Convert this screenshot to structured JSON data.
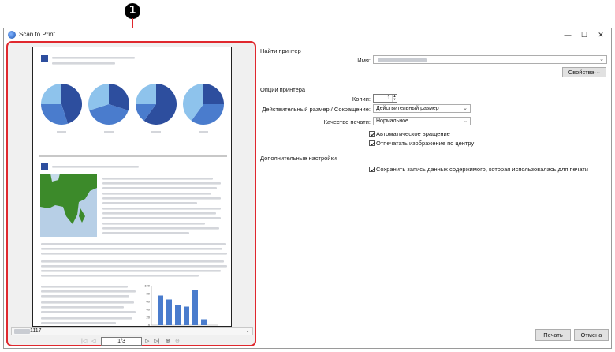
{
  "callout": {
    "label": "1"
  },
  "window": {
    "title": "Scan to Print",
    "controls": {
      "minimize": "—",
      "maximize": "☐",
      "close": "✕"
    }
  },
  "preview": {
    "file_name": "1117",
    "page_indicator": "1/3",
    "nav_icons": [
      "first-page-icon",
      "prev-page-icon",
      "next-page-icon",
      "last-page-icon",
      "zoom-in-icon",
      "zoom-out-icon"
    ],
    "bar_chart": {
      "type": "bar",
      "y_ticks": [
        "100",
        "80",
        "60",
        "40",
        "20",
        "0"
      ],
      "values": [
        75,
        65,
        50,
        47,
        90,
        15
      ],
      "ylim": [
        0,
        100
      ]
    },
    "pie_charts": [
      {
        "slices": [
          0.45,
          0.3,
          0.25
        ]
      },
      {
        "slices": [
          0.3,
          0.4,
          0.3
        ]
      },
      {
        "slices": [
          0.6,
          0.15,
          0.25
        ]
      },
      {
        "slices": [
          0.25,
          0.35,
          0.4
        ]
      }
    ],
    "colors": {
      "dark_blue": "#2d4e9e",
      "mid_blue": "#4a7ccd",
      "light_blue": "#8ec3ec",
      "map_green": "#3c8a2a",
      "map_sea": "#b7cfe6"
    }
  },
  "settings": {
    "find_printer": {
      "title": "Найти принтер",
      "name_label": "Имя:",
      "properties_button": "Свойства···"
    },
    "printer_options": {
      "title": "Опции принтера",
      "copies_label": "Копии:",
      "copies_value": "1",
      "size_label": "Действительный размер / Сокращение:",
      "size_value": "Действительный размер",
      "quality_label": "Качество печати:",
      "quality_value": "Нормальное",
      "auto_rotate": "Автоматическое вращение",
      "auto_rotate_checked": true,
      "center_image": "Отпечатать изображение по центру",
      "center_image_checked": true
    },
    "additional": {
      "title": "Дополнительные настройки",
      "save_record": "Сохранить запись данных содержимого, которая использовалась для печати",
      "save_record_checked": true
    }
  },
  "footer": {
    "print_button": "Печать",
    "cancel_button": "Отмена"
  }
}
